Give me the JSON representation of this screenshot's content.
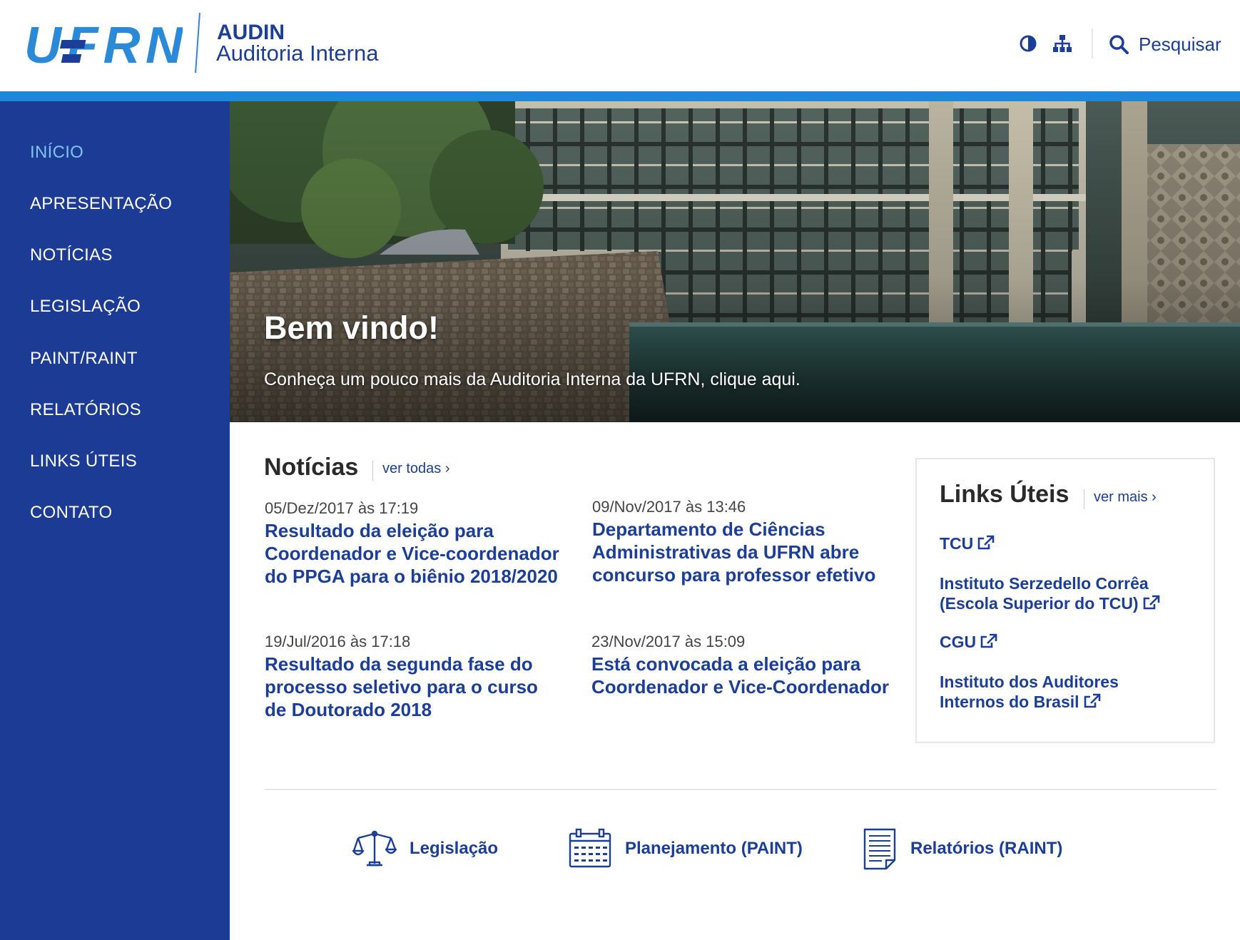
{
  "header": {
    "logo_text": "UFRN",
    "acronym": "AUDIN",
    "site_name": "Auditoria Interna",
    "contrast_icon": "contrast-icon",
    "sitemap_icon": "sitemap-icon",
    "search_icon": "search-icon",
    "search_label": "Pesquisar"
  },
  "sidebar": {
    "items": [
      {
        "label": "INÍCIO",
        "active": true
      },
      {
        "label": "APRESENTAÇÃO"
      },
      {
        "label": "NOTÍCIAS"
      },
      {
        "label": "LEGISLAÇÃO"
      },
      {
        "label": "PAINT/RAINT"
      },
      {
        "label": "RELATÓRIOS"
      },
      {
        "label": "LINKS ÚTEIS"
      },
      {
        "label": "CONTATO"
      }
    ]
  },
  "hero": {
    "title": "Bem vindo!",
    "subtitle": "Conheça um pouco mais da Auditoria Interna da UFRN, clique aqui."
  },
  "news": {
    "title": "Notícias",
    "see_all": "ver todas ›",
    "items": [
      {
        "date": "05/Dez/2017 às 17:19",
        "title": "Resultado da eleição para Coordenador e Vice-coordenador do PPGA para o biênio 2018/2020"
      },
      {
        "date": "09/Nov/2017 às 13:46",
        "title": "Departamento de Ciências Administrativas da UFRN abre concurso para professor efetivo"
      },
      {
        "date": "19/Jul/2016 às 17:18",
        "title": "Resultado da segunda fase do processo seletivo para o curso de Doutorado 2018"
      },
      {
        "date": "23/Nov/2017 às 15:09",
        "title": "Está convocada a eleição para Coordenador e Vice-Coordenador"
      }
    ]
  },
  "links": {
    "title": "Links Úteis",
    "see_more": "ver mais ›",
    "external_icon": "external-link-icon",
    "items": [
      {
        "label": "TCU"
      },
      {
        "label": "Instituto Serzedello Corrêa (Escola Superior do TCU)"
      },
      {
        "label": "CGU"
      },
      {
        "label": "Instituto dos Auditores Internos do Brasil"
      }
    ]
  },
  "shortcuts": [
    {
      "label": "Legislação",
      "icon": "scales-icon"
    },
    {
      "label": "Planejamento (PAINT)",
      "icon": "calendar-icon"
    },
    {
      "label": "Relatórios (RAINT)",
      "icon": "document-icon"
    }
  ],
  "colors": {
    "primary": "#1b3f99",
    "sidebar": "#1c3b95",
    "accent_bar": "#1e88d8",
    "active_nav": "#7fc2f4",
    "logo_light": "#2a8ad8",
    "logo_dark": "#1b3f99"
  }
}
